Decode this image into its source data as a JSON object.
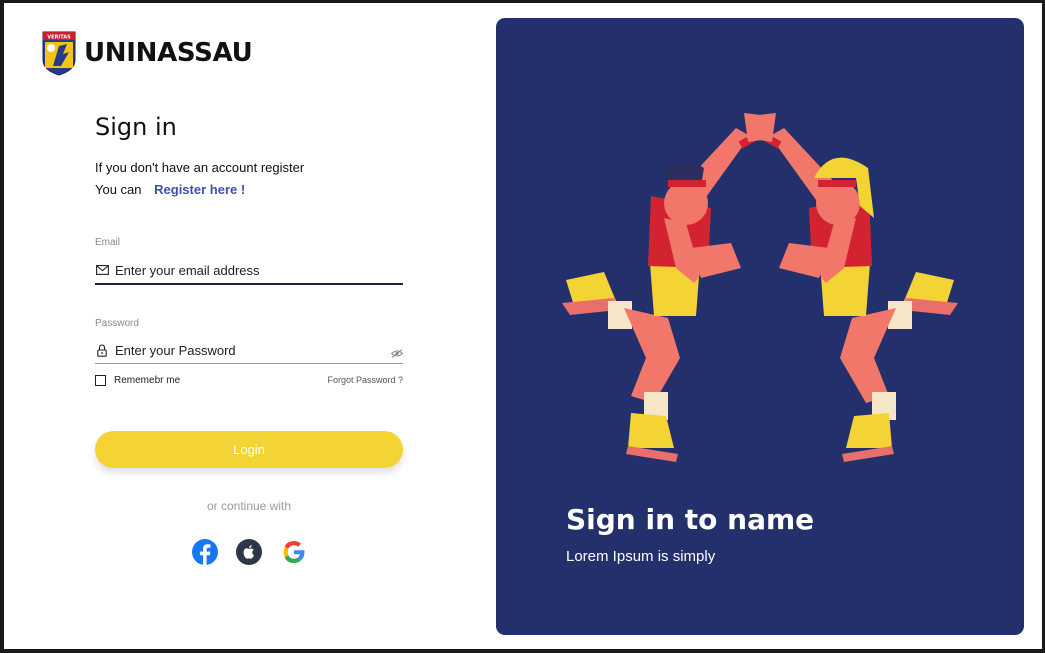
{
  "brand": {
    "name": "UNINASSAU",
    "crest_text": "VERITAS"
  },
  "signin": {
    "title": "Sign in",
    "subtitle": "If you don't have an account register",
    "register_prefix": "You can",
    "register_link": "Register here !"
  },
  "form": {
    "email_label": "Email",
    "email_placeholder": "Enter your email address",
    "password_label": "Password",
    "password_placeholder": "Enter your Password",
    "remember_label": "Rememebr me",
    "forgot_label": "Forgot Password ?",
    "login_label": "Login"
  },
  "social": {
    "or_text": "or continue with",
    "providers": [
      "facebook-icon",
      "apple-icon",
      "google-icon"
    ]
  },
  "panel": {
    "title": "Sign in to name",
    "subtitle": "Lorem Ipsum is simply"
  },
  "colors": {
    "panel_bg": "#23306b",
    "accent_yellow": "#f4d435",
    "link_blue": "#3f4fb5"
  }
}
